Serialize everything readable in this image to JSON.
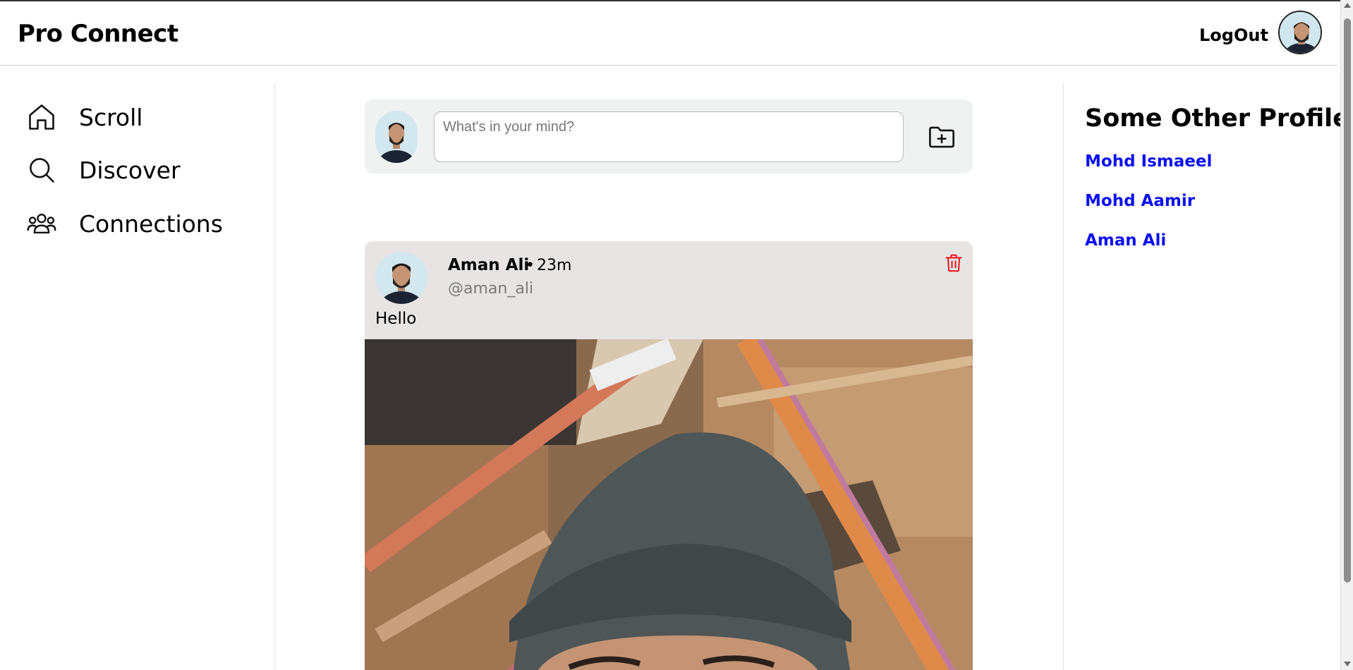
{
  "header": {
    "brand": "Pro Connect",
    "logout_label": "LogOut",
    "avatar_icon": "user-avatar-icon"
  },
  "sidebar": {
    "items": [
      {
        "label": "Scroll",
        "icon": "home-icon"
      },
      {
        "label": "Discover",
        "icon": "search-icon"
      },
      {
        "label": "Connections",
        "icon": "people-icon"
      }
    ]
  },
  "create_post": {
    "placeholder": "What's in your mind?",
    "value": "",
    "upload_icon": "folder-plus-icon"
  },
  "post": {
    "author_name": "Aman Ali",
    "separator": "•",
    "time_ago": "23m",
    "handle": "@aman_ali",
    "body": "Hello",
    "delete_icon": "trash-icon",
    "delete_color": "#e8141b"
  },
  "right_panel": {
    "title": "Some Other Profile:",
    "profiles": [
      "Mohd Ismaeel",
      "Mohd Aamir",
      "Aman Ali"
    ],
    "link_color": "#0b10ee"
  }
}
